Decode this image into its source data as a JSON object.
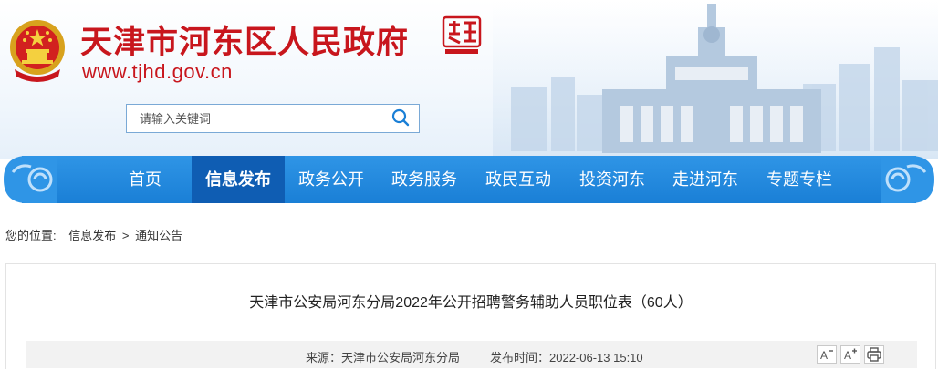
{
  "header": {
    "site_title": "天津市河东区人民政府",
    "site_url": "www.tjhd.gov.cn",
    "seal_text": "天津河东",
    "brand_color": "#c8161d"
  },
  "search": {
    "placeholder": "请输入关键词",
    "value": ""
  },
  "nav": {
    "items": [
      {
        "label": "首页",
        "active": false
      },
      {
        "label": "信息发布",
        "active": true
      },
      {
        "label": "政务公开",
        "active": false
      },
      {
        "label": "政务服务",
        "active": false
      },
      {
        "label": "政民互动",
        "active": false
      },
      {
        "label": "投资河东",
        "active": false
      },
      {
        "label": "走进河东",
        "active": false
      },
      {
        "label": "专题专栏",
        "active": false
      }
    ],
    "bar_color": "#1a7fd6",
    "active_color": "#0f5db3"
  },
  "breadcrumb": {
    "lead": "您的位置:",
    "items": [
      "信息发布",
      "通知公告"
    ],
    "separator": ">"
  },
  "article": {
    "title": "天津市公安局河东分局2022年公开招聘警务辅助人员职位表（60人）",
    "source": "来源：天津市公安局河东分局",
    "publish_time": "发布时间：2022-06-13 15:10"
  },
  "icons": {
    "emblem": "national-emblem-icon",
    "search": "search-icon",
    "font_smaller": "font-decrease-icon",
    "font_larger": "font-increase-icon",
    "print": "printer-icon"
  }
}
